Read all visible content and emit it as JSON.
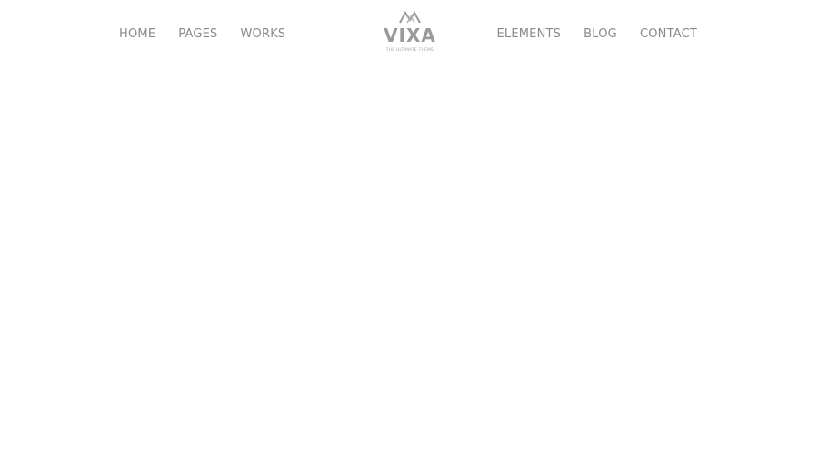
{
  "nav_left": [
    {
      "label": "HOME"
    },
    {
      "label": "PAGES"
    },
    {
      "label": "WORKS"
    }
  ],
  "logo": {
    "wordmark": "VIXA",
    "tagline": "THE ULTIMATE THEME",
    "icon": "mountain-icon"
  },
  "nav_right": [
    {
      "label": "ELEMENTS"
    },
    {
      "label": "BLOG"
    },
    {
      "label": "CONTACT"
    }
  ],
  "colors": {
    "background": "#ffffff",
    "nav_text": "#8a8a8a",
    "logo": "#9a9a9a"
  }
}
